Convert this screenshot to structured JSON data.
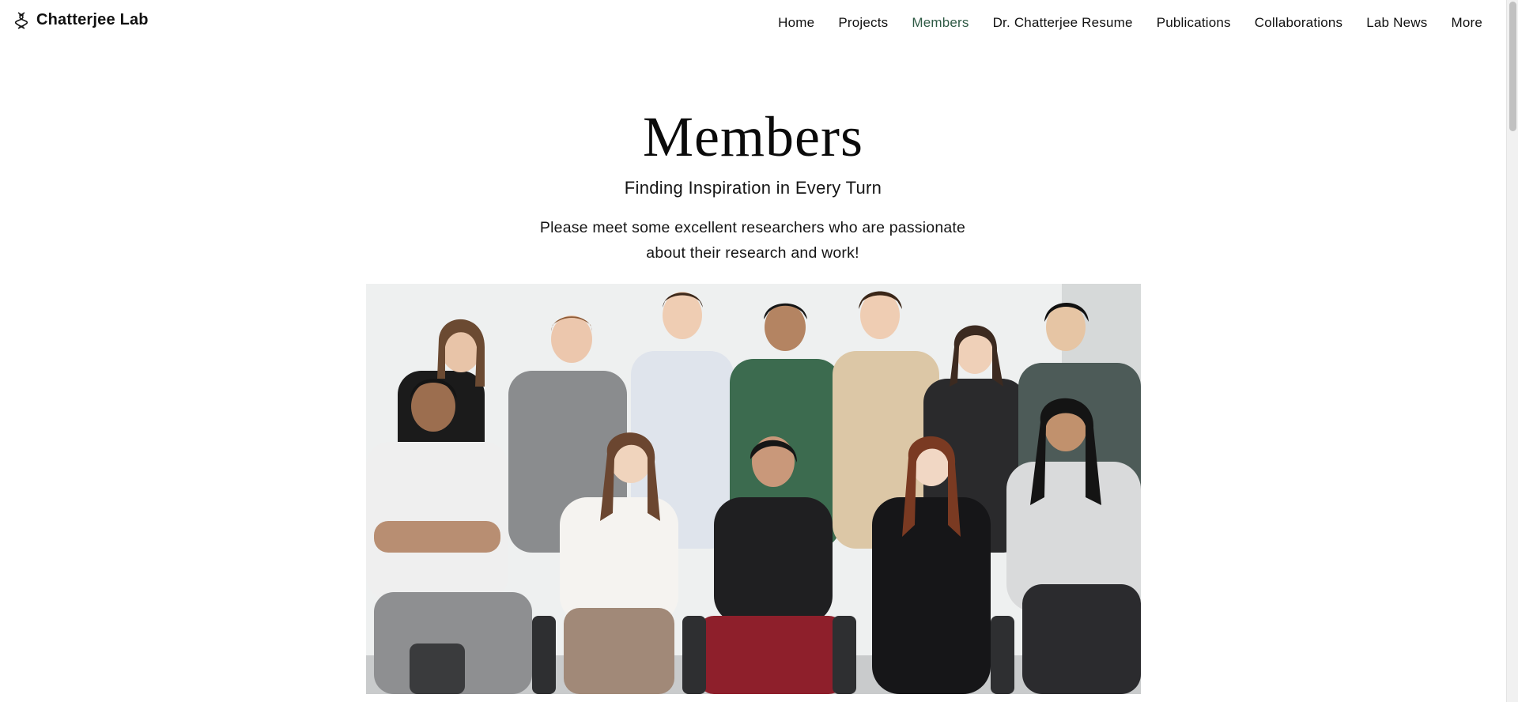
{
  "header": {
    "brand_name": "Chatterjee Lab",
    "logo_icon": "dna-icon",
    "nav": [
      {
        "label": "Home",
        "active": false
      },
      {
        "label": "Projects",
        "active": false
      },
      {
        "label": "Members",
        "active": true
      },
      {
        "label": "Dr. Chatterjee Resume",
        "active": false
      },
      {
        "label": "Publications",
        "active": false
      },
      {
        "label": "Collaborations",
        "active": false
      },
      {
        "label": "Lab News",
        "active": false
      },
      {
        "label": "More",
        "active": false
      }
    ]
  },
  "main": {
    "title": "Members",
    "subtitle": "Finding Inspiration in Every Turn",
    "intro_line1": "Please meet some excellent researchers who are passionate",
    "intro_line2": "about their research and work!"
  },
  "colors": {
    "accent": "#2f5a45",
    "text": "#111111",
    "background": "#ffffff"
  }
}
